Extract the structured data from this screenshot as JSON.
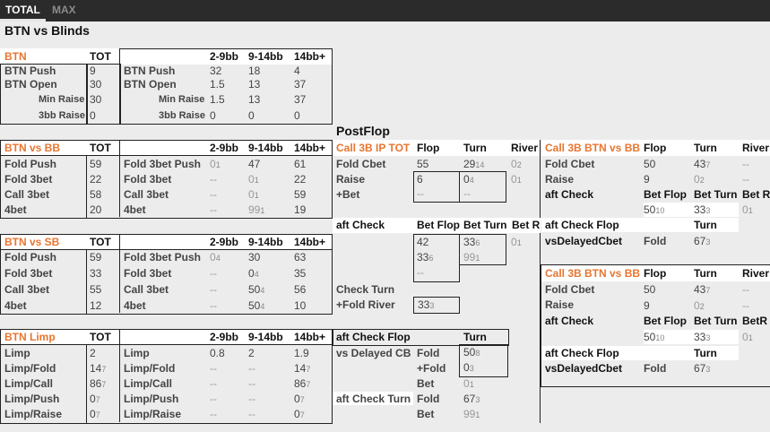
{
  "tabs": [
    "TOTAL",
    "MAX"
  ],
  "section_title": "BTN vs Blinds",
  "postflop_title": "PostFlop",
  "cols": {
    "tot": "TOT",
    "b1": "2-9bb",
    "b2": "9-14bb",
    "b3": "14bb+"
  },
  "btn": {
    "title": "BTN",
    "push": "BTN Push",
    "open": "BTN Open",
    "min_raise": "Min Raise",
    "raise3": "3bb Raise",
    "tot": [
      "9",
      "30",
      "30",
      "0"
    ],
    "b1": [
      "32",
      "1.5",
      "1.5",
      "0"
    ],
    "b2": [
      "18",
      "13",
      "13",
      "0"
    ],
    "b3": [
      "4",
      "37",
      "37",
      "0"
    ]
  },
  "btn_vs_bb": {
    "title": "BTN vs BB",
    "l": [
      "Fold Push",
      "Fold 3bet",
      "Call 3bet",
      "4bet"
    ],
    "r": [
      "Fold 3bet Push",
      "Fold 3bet",
      "Call 3bet",
      "4bet"
    ],
    "tot": [
      "59",
      "22",
      "58",
      "20"
    ],
    "b1": [
      "0",
      "--",
      "--",
      "--"
    ],
    "b1s": [
      "1",
      "",
      "",
      ""
    ],
    "b2": [
      "47",
      "0",
      "0",
      "99"
    ],
    "b2s": [
      "",
      "1",
      "1",
      "1"
    ],
    "b3": [
      "61",
      "22",
      "59",
      "19"
    ]
  },
  "btn_vs_sb": {
    "title": "BTN vs SB",
    "l": [
      "Fold Push",
      "Fold 3bet",
      "Call 3bet",
      "4bet"
    ],
    "r": [
      "Fold 3bet Push",
      "Fold 3bet",
      "Call 3bet",
      "4bet"
    ],
    "tot": [
      "59",
      "33",
      "55",
      "12"
    ],
    "b1": [
      "0",
      "--",
      "--",
      "--"
    ],
    "b1s": [
      "4",
      "",
      "",
      ""
    ],
    "b2": [
      "30",
      "0",
      "50",
      "50"
    ],
    "b2s": [
      "",
      "4",
      "4",
      "4"
    ],
    "b3": [
      "63",
      "35",
      "56",
      "10"
    ]
  },
  "btn_limp": {
    "title": "BTN Limp",
    "l": [
      "Limp",
      "Limp/Fold",
      "Limp/Call",
      "Limp/Push",
      "Limp/Raise"
    ],
    "tot": [
      "2",
      "14",
      "86",
      "0",
      "0"
    ],
    "tots": [
      "",
      "7",
      "7",
      "7",
      "7"
    ],
    "b1": [
      "0.8",
      "--",
      "--",
      "--",
      "--"
    ],
    "b2": [
      "2",
      "--",
      "--",
      "--",
      "--"
    ],
    "b3": [
      "1.9",
      "14",
      "86",
      "0",
      "0"
    ],
    "b3s": [
      "",
      "7",
      "7",
      "7",
      "7"
    ]
  },
  "ip": {
    "title": "Call 3B IP TOT",
    "flop": "Flop",
    "turn": "Turn",
    "river": "River",
    "fold_cbet": "Fold Cbet",
    "raise": "Raise",
    "bet": "+Bet",
    "fc_flop": "55",
    "fc_turn": "29",
    "fc_turn_s": "14",
    "fc_river": "0",
    "fc_river_s": "2",
    "r_flop": "6",
    "r_turn": "0",
    "r_turn_s": "4",
    "r_river": "0",
    "r_river_s": "1",
    "b_flop": "--",
    "b_turn": "--",
    "aft_check": "aft Check",
    "bet_flop": "Bet Flop",
    "bet_turn": "Bet Turn",
    "bet_r": "Bet R",
    "ac1": "42",
    "ac2": "33",
    "ac2s": "6",
    "ac3": "0",
    "ac3s": "1",
    "ac4": "33",
    "ac4s": "6",
    "ac5": "99",
    "ac5s": "1",
    "ac6": "--",
    "check_turn": "Check Turn",
    "fold_river": "+Fold River",
    "ctfr": "33",
    "ctfr_s": "3"
  },
  "acf": {
    "title": "aft Check Flop",
    "turn": "Turn",
    "vs_delayed": "vs Delayed CB",
    "fold": "Fold",
    "plus_fold": "+Fold",
    "bet": "Bet",
    "v1": "50",
    "v1s": "8",
    "v2": "0",
    "v2s": "3",
    "v3": "0",
    "v3s": "1",
    "act": "aft Check Turn",
    "act_fold": "Fold",
    "act_bet": "Bet",
    "v4": "67",
    "v4s": "3",
    "v5": "99",
    "v5s": "1"
  },
  "btnbb1": {
    "title": "Call 3B BTN vs BB",
    "flop": "Flop",
    "turn": "Turn",
    "river": "River",
    "fold_cbet": "Fold Cbet",
    "raise": "Raise",
    "aft_check": "aft Check",
    "bet_flop": "Bet Flop",
    "bet_turn": "Bet Turn",
    "bet_r": "Bet R",
    "fc1": "50",
    "fc2": "43",
    "fc2s": "7",
    "fc3": "--",
    "r1": "9",
    "r2": "0",
    "r2s": "2",
    "r3": "--",
    "a1": "50",
    "a1s": "10",
    "a2": "33",
    "a2s": "3",
    "a3": "0",
    "a3s": "1",
    "acf": "aft Check Flop",
    "acf_turn": "Turn",
    "vsd": "vsDelayedCbet",
    "vsd_fold": "Fold",
    "vsd_v": "67",
    "vsd_s": "3"
  },
  "btnbb2": {
    "title": "Call 3B BTN vs BB",
    "flop": "Flop",
    "turn": "Turn",
    "river": "River",
    "fold_cbet": "Fold Cbet",
    "raise": "Raise",
    "aft_check": "aft Check",
    "bet_flop": "Bet Flop",
    "bet_turn": "Bet Turn",
    "bet_r": "BetR",
    "fc1": "50",
    "fc2": "43",
    "fc2s": "7",
    "fc3": "--",
    "r1": "9",
    "r2": "0",
    "r2s": "2",
    "r3": "--",
    "a1": "50",
    "a1s": "10",
    "a2": "33",
    "a2s": "3",
    "a3": "0",
    "a3s": "1",
    "acf": "aft Check Flop",
    "acf_turn": "Turn",
    "vsd": "vsDelayedCbet",
    "vsd_fold": "Fold",
    "vsd_v": "67",
    "vsd_s": "3"
  }
}
